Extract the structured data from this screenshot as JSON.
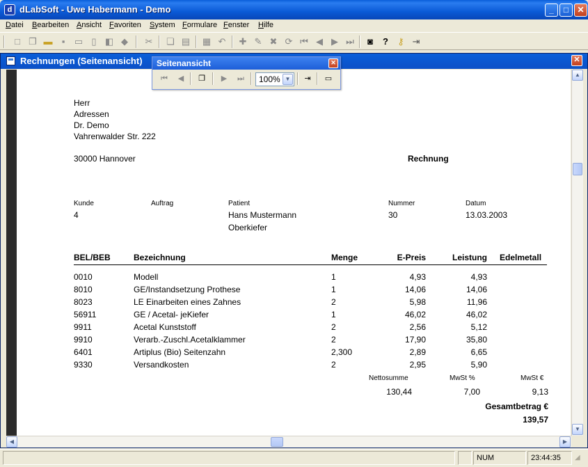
{
  "app": {
    "title": "dLabSoft - Uwe Habermann - Demo",
    "icon_glyph": "d",
    "window_buttons": {
      "minimize": "_",
      "maximize": "□",
      "close": "✕"
    }
  },
  "menu": [
    "Datei",
    "Bearbeiten",
    "Ansicht",
    "Favoriten",
    "System",
    "Formulare",
    "Fenster",
    "Hilfe"
  ],
  "toolbar": {
    "icons": [
      "new-icon",
      "copy-doc-icon",
      "open-folder-icon",
      "save-icon",
      "print-icon",
      "print-preview-icon",
      "export-icon",
      "package-icon",
      "cut-icon",
      "copy-icon",
      "paste-icon",
      "form-icon",
      "undo-icon",
      "insert-record-icon",
      "edit-record-icon",
      "delete-record-icon",
      "refresh-record-icon",
      "first-record-icon",
      "prev-record-icon",
      "next-record-icon",
      "last-record-icon",
      "camera-icon",
      "help-icon",
      "keys-icon",
      "exit-icon"
    ]
  },
  "child_window": {
    "title": "Rechnungen (Seitenansicht)",
    "close": "✕"
  },
  "preview_toolbar": {
    "title": "Seitenansicht",
    "close": "✕",
    "zoom": "100%"
  },
  "invoice": {
    "address": [
      "Herr",
      "Adressen",
      "Dr. Demo",
      "Vahrenwalder Str. 222"
    ],
    "city": "30000 Hannover",
    "doc_title": "Rechnung",
    "meta_labels": {
      "kunde": "Kunde",
      "auftrag": "Auftrag",
      "patient": "Patient",
      "nummer": "Nummer",
      "datum": "Datum"
    },
    "meta_values": {
      "kunde": "4",
      "auftrag": "",
      "patient": "Hans Mustermann",
      "patient2": "Oberkiefer",
      "nummer": "30",
      "datum": "13.03.2003"
    },
    "columns": {
      "bel": "BEL/BEB",
      "bez": "Bezeichnung",
      "menge": "Menge",
      "epreis": "E-Preis",
      "leistung": "Leistung",
      "edelmetall": "Edelmetall"
    },
    "rows": [
      {
        "bel": "0010",
        "bez": "Modell",
        "menge": "1",
        "epreis": "4,93",
        "leistung": "4,93"
      },
      {
        "bel": "8010",
        "bez": "GE/Instandsetzung Prothese",
        "menge": "1",
        "epreis": "14,06",
        "leistung": "14,06"
      },
      {
        "bel": "8023",
        "bez": "LE Einarbeiten eines Zahnes",
        "menge": "2",
        "epreis": "5,98",
        "leistung": "11,96"
      },
      {
        "bel": "56911",
        "bez": "GE / Acetal- jeKiefer",
        "menge": "1",
        "epreis": "46,02",
        "leistung": "46,02"
      },
      {
        "bel": "9911",
        "bez": "Acetal Kunststoff",
        "menge": "2",
        "epreis": "2,56",
        "leistung": "5,12"
      },
      {
        "bel": "9910",
        "bez": "Verarb.-Zuschl.Acetalklammer",
        "menge": "2",
        "epreis": "17,90",
        "leistung": "35,80"
      },
      {
        "bel": "6401",
        "bez": "Artiplus (Bio) Seitenzahn",
        "menge": "2,300",
        "epreis": "2,89",
        "leistung": "6,65"
      },
      {
        "bel": "9330",
        "bez": "Versandkosten",
        "menge": "2",
        "epreis": "2,95",
        "leistung": "5,90"
      }
    ],
    "totals_labels": {
      "netto": "Nettosumme",
      "mwst_pct": "MwSt %",
      "mwst_eur": "MwSt €"
    },
    "totals_values": {
      "netto": "130,44",
      "mwst_pct": "7,00",
      "mwst_eur": "9,13"
    },
    "gesamt_label": "Gesamtbetrag €",
    "gesamt_value": "139,57"
  },
  "status": {
    "num": "NUM",
    "time": "23:44:35"
  }
}
